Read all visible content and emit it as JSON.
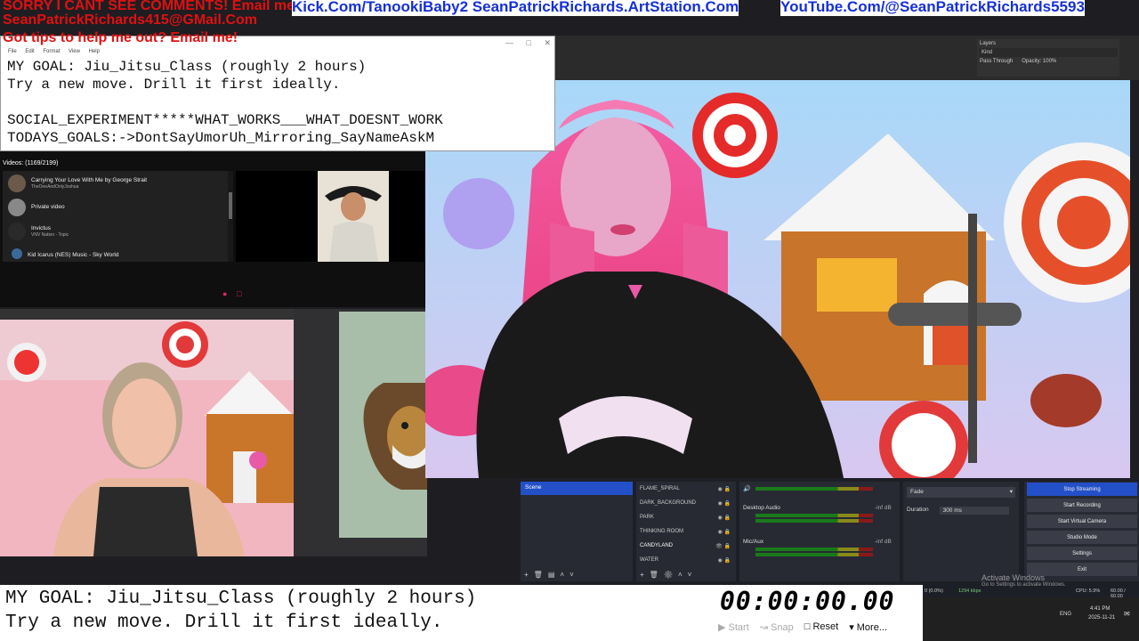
{
  "banner": {
    "line1_red": "SORRY I CANT SEE COMMENTS! Email me:",
    "line1_blue": "Kick.Com/TanookiBaby2 SeanPatrickRichards.ArtStation.Com",
    "line1_blue2": "YouTube.Com/@SeanPatrickRichards5593",
    "line2": "SeanPatrickRichards415@GMail.Com",
    "line3": "Got tips to help me out? Email me!"
  },
  "notepad": {
    "menu": [
      "File",
      "Edit",
      "Format",
      "View",
      "Help"
    ],
    "lines": [
      "MY GOAL: Jiu_Jitsu_Class (roughly 2 hours)",
      "Try a new move. Drill it first ideally.",
      "",
      "SOCIAL_EXPERIMENT*****WHAT_WORKS___WHAT_DOESNT_WORK",
      "TODAYS_GOALS:->DontSayUmorUh_Mirroring_SayNameAskM"
    ]
  },
  "photoshop": {
    "panel_title": "Layers",
    "kind": "Kind",
    "blend": "Pass Through",
    "opacity": "Opacity: 100%"
  },
  "youtube": {
    "header": "Videos: (1169/2199)",
    "items": [
      {
        "title": "Carrying Your Love With Me by George Strait",
        "sub": "TheOneAndOnlyJoshua"
      },
      {
        "title": "Private video",
        "sub": ""
      },
      {
        "title": "Invictus",
        "sub": "VNV Nation - Topic"
      },
      {
        "title": "Kid Icarus (NES) Music - Sky World",
        "sub": ""
      }
    ]
  },
  "obs": {
    "scenes_title": "Scene",
    "sources": [
      "FLAME_SPIRAL",
      "DARK_BACKGROUND",
      "PARK",
      "THINKING ROOM",
      "CANDYLAND",
      "WATER"
    ],
    "mixer": [
      {
        "name": "Desktop Audio",
        "level": "-inf dB"
      },
      {
        "name": "Mic/Aux",
        "level": "-inf dB"
      }
    ],
    "transition": "Fade",
    "duration_label": "Duration",
    "duration_value": "300 ms",
    "controls": [
      "Stop Streaming",
      "Start Recording",
      "Start Virtual Camera",
      "Studio Mode",
      "Settings",
      "Exit"
    ]
  },
  "bottom_text": {
    "line1": "MY GOAL: Jiu_Jitsu_Class (roughly 2 hours)",
    "line2": "Try a new move. Drill it first ideally."
  },
  "timer": {
    "display": "00:00:00.00",
    "start": "Start",
    "snap": "Snap",
    "reset": "Reset",
    "more": "More..."
  },
  "status_bar": {
    "dropped": "0 (0.0%)",
    "kbps": "1294 kbps",
    "cpu": "CPU: 5.9%",
    "fps": "60.00 / 60.00"
  },
  "taskbar": {
    "lang": "ENG",
    "time": "4:41 PM",
    "date": "2025-11-21"
  },
  "watermark": {
    "title": "Activate Windows",
    "sub": "Go to Settings to activate Windows."
  }
}
